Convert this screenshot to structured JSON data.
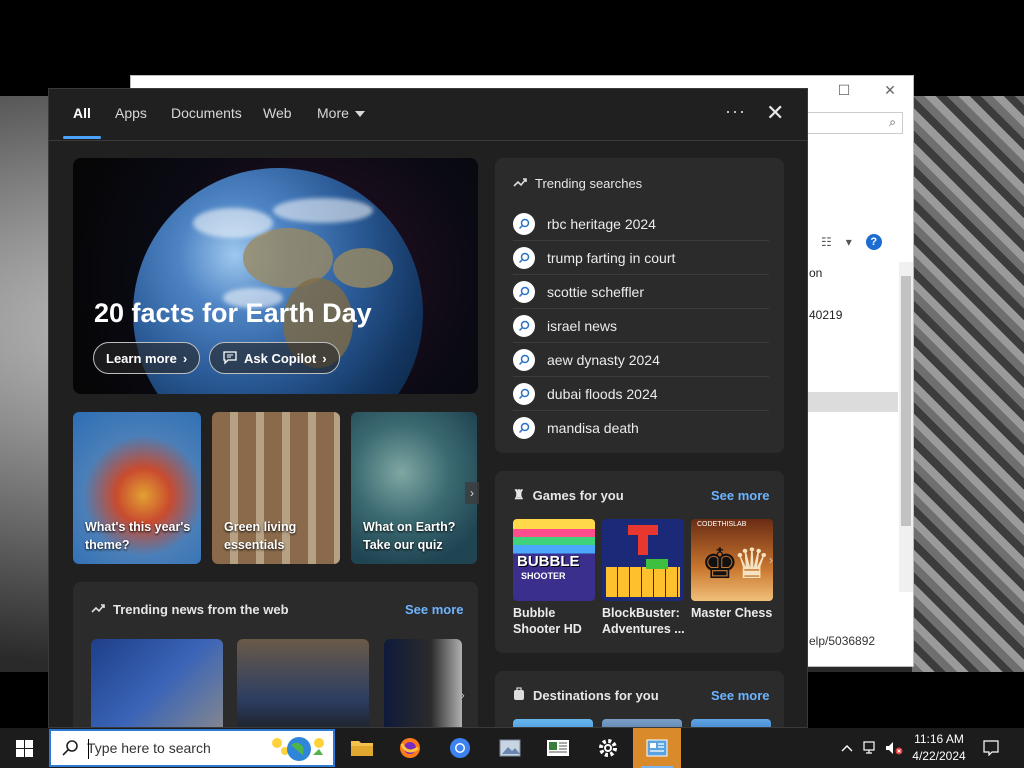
{
  "panel": {
    "tabs": [
      "All",
      "Apps",
      "Documents",
      "Web",
      "More"
    ],
    "more_menu_icon": "ellipsis-icon",
    "close_icon": "close-icon"
  },
  "hero": {
    "title": "20 facts for Earth Day",
    "learn_more": "Learn more",
    "ask_copilot": "Ask Copilot"
  },
  "tiles": [
    {
      "line1": "What's this year's",
      "line2": "theme?"
    },
    {
      "line1": "Green living",
      "line2": "essentials"
    },
    {
      "line1": "What on Earth?",
      "line2": "Take our quiz"
    }
  ],
  "trending_news": {
    "header": "Trending news from the web",
    "see_more": "See more"
  },
  "trending_searches": {
    "header": "Trending searches",
    "items": [
      "rbc heritage 2024",
      "trump farting in court",
      "scottie scheffler",
      "israel news",
      "aew dynasty 2024",
      "dubai floods 2024",
      "mandisa death"
    ]
  },
  "games": {
    "header": "Games for you",
    "see_more": "See more",
    "items": [
      {
        "line1": "Bubble",
        "line2": "Shooter HD"
      },
      {
        "line1": "BlockBuster:",
        "line2": "Adventures ..."
      },
      {
        "line1": "Master Chess",
        "line2": ""
      }
    ],
    "bubble_logo_line1": "BUBBLE",
    "bubble_logo_line2": "SHOOTER",
    "chess_logo": "CODETHISLAB"
  },
  "destinations": {
    "header": "Destinations for you",
    "see_more": "See more"
  },
  "taskbar": {
    "search_placeholder": "Type here to search",
    "time": "11:16 AM",
    "date": "4/22/2024"
  },
  "background_window": {
    "col_text_1": "on",
    "col_text_2": "40219",
    "status_text": "elp/5036892"
  }
}
